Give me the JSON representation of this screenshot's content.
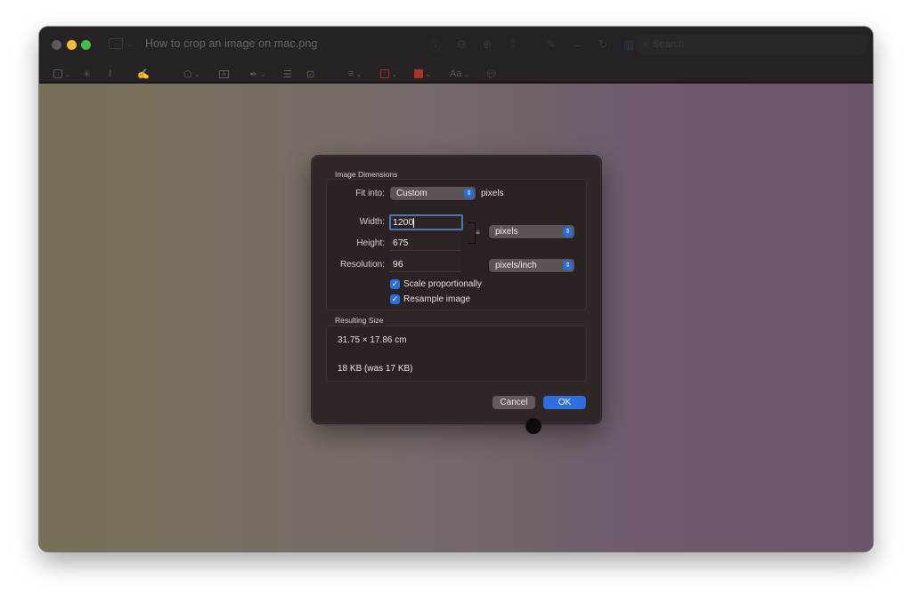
{
  "window": {
    "title": "How to crop an image on mac.png",
    "search_placeholder": "Search"
  },
  "toolbar": {
    "top_icons": [
      "info-icon",
      "zoom-out-icon",
      "zoom-in-icon",
      "share-icon",
      "markup-pen-icon",
      "minus-icon",
      "rotate-icon",
      "markup-toolbar-icon"
    ],
    "markup_tools": [
      "rectangular-selection-icon",
      "instant-alpha-icon",
      "sketch-icon",
      "draw-icon",
      "shapes-icon",
      "text-box-icon",
      "sign-icon",
      "adjust-color-icon",
      "adjust-size-icon",
      "shape-style-icon",
      "border-color-icon",
      "fill-color-icon",
      "text-style-icon",
      "annotate-icon"
    ],
    "text_style_label": "Aa",
    "border_color": "#a03030",
    "fill_color": "#a8342c"
  },
  "dialog": {
    "image_dimensions_label": "Image Dimensions",
    "fit_into_label": "Fit into:",
    "fit_into_value": "Custom",
    "fit_into_unit": "pixels",
    "width_label": "Width:",
    "width_value": "1200",
    "height_label": "Height:",
    "height_value": "675",
    "size_unit_value": "pixels",
    "resolution_label": "Resolution:",
    "resolution_value": "96",
    "resolution_unit_value": "pixels/inch",
    "scale_proportionally_label": "Scale proportionally",
    "scale_proportionally_checked": true,
    "resample_image_label": "Resample image",
    "resample_image_checked": true,
    "resulting_size_label": "Resulting Size",
    "resulting_dimensions": "31.75 × 17.86 cm",
    "resulting_file_size": "18 KB (was 17 KB)",
    "cancel_label": "Cancel",
    "ok_label": "OK",
    "accent_color": "#2f6fdc"
  }
}
